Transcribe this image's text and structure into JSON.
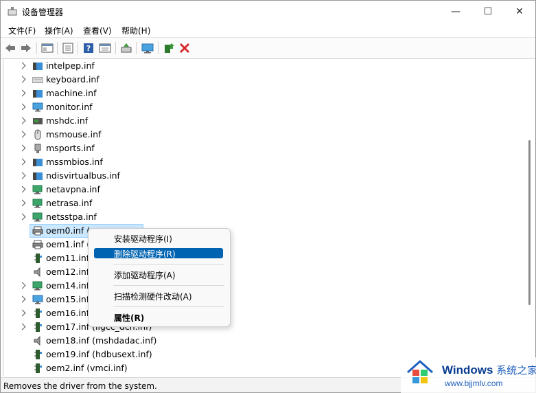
{
  "window": {
    "title": "设备管理器",
    "controls": {
      "minimize": "—",
      "maximize": "☐",
      "close": "✕"
    }
  },
  "menubar": {
    "items": [
      {
        "label": "文件(F)"
      },
      {
        "label": "操作(A)"
      },
      {
        "label": "查看(V)"
      },
      {
        "label": "帮助(H)"
      }
    ]
  },
  "toolbar": {
    "buttons": [
      "back-arrow-icon",
      "forward-arrow-icon",
      "device-view-icon",
      "properties-icon",
      "help-icon",
      "device-tree-icon",
      "update-driver-icon",
      "monitor-icon",
      "enable-device-icon",
      "uninstall-x-icon"
    ],
    "uninstall_color": "#d92b2b"
  },
  "tree": {
    "items": [
      {
        "label": "intelpep.inf",
        "icon": "system-folder-icon",
        "expandable": true
      },
      {
        "label": "keyboard.inf",
        "icon": "keyboard-icon",
        "expandable": true
      },
      {
        "label": "machine.inf",
        "icon": "system-folder-icon",
        "expandable": true
      },
      {
        "label": "monitor.inf",
        "icon": "monitor-icon",
        "expandable": true
      },
      {
        "label": "mshdc.inf",
        "icon": "disk-controller-icon",
        "expandable": true
      },
      {
        "label": "msmouse.inf",
        "icon": "mouse-icon",
        "expandable": true
      },
      {
        "label": "msports.inf",
        "icon": "port-icon",
        "expandable": true
      },
      {
        "label": "mssmbios.inf",
        "icon": "system-folder-icon",
        "expandable": true
      },
      {
        "label": "ndisvirtualbus.inf",
        "icon": "system-folder-icon",
        "expandable": true
      },
      {
        "label": "netavpna.inf",
        "icon": "network-icon",
        "expandable": true
      },
      {
        "label": "netrasa.inf",
        "icon": "network-icon",
        "expandable": true
      },
      {
        "label": "netsstpa.inf",
        "icon": "network-icon",
        "expandable": true
      },
      {
        "label": "oem0.inf (p",
        "icon": "printer-icon",
        "expandable": false,
        "selected": true
      },
      {
        "label": "oem1.inf (p",
        "icon": "printer-icon",
        "expandable": false
      },
      {
        "label": "oem11.inf",
        "icon": "bus-controller-icon",
        "expandable": false
      },
      {
        "label": "oem12.inf",
        "icon": "speaker-icon",
        "expandable": false
      },
      {
        "label": "oem14.inf",
        "icon": "network-icon",
        "expandable": true
      },
      {
        "label": "oem15.inf",
        "icon": "monitor-icon",
        "expandable": true
      },
      {
        "label": "oem16.inf",
        "icon": "bus-controller-icon",
        "expandable": true
      },
      {
        "label": "oem17.inf (iigcc_dch.inf)",
        "icon": "bus-controller-icon",
        "expandable": true
      },
      {
        "label": "oem18.inf (mshdadac.inf)",
        "icon": "speaker-icon",
        "expandable": false
      },
      {
        "label": "oem19.inf (hdbusext.inf)",
        "icon": "bus-controller-icon",
        "expandable": false
      },
      {
        "label": "oem2.inf (vmci.inf)",
        "icon": "bus-controller-icon",
        "expandable": false
      }
    ]
  },
  "context_menu": {
    "items": [
      {
        "label": "安装驱动程序(I)"
      },
      {
        "label": "删除驱动程序(R)",
        "highlighted": true
      },
      {
        "label": "添加驱动程序(A)"
      },
      {
        "label": "扫描检测硬件改动(A)"
      },
      {
        "label": "属性(R)",
        "bold": true
      }
    ],
    "highlight_color": "#0063b1"
  },
  "status": {
    "text": "Removes the driver from the system."
  },
  "watermark": {
    "brand": "Windows",
    "brand_cn": "系统之家",
    "url": "www.bjjmlv.com"
  }
}
